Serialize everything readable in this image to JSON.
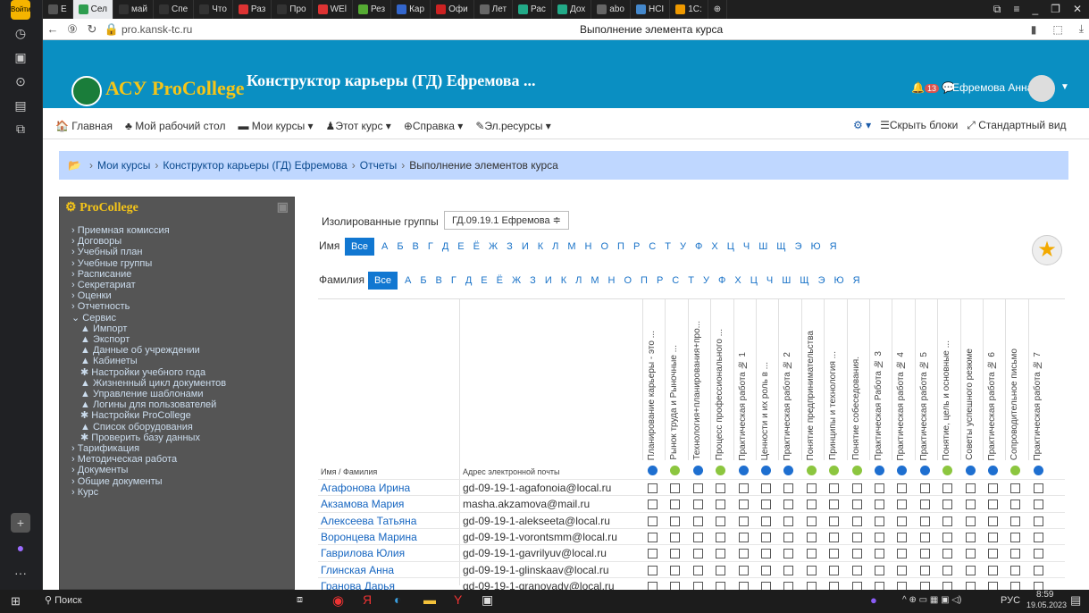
{
  "browser": {
    "tabs": [
      "Е",
      "Сел",
      "май",
      "Спе",
      "Что",
      "Раз",
      "Про",
      "WEl",
      "Рез",
      "Кар",
      "Офи",
      "Лет",
      "Рас",
      "Дох",
      "abo",
      "НСI",
      "1С:"
    ],
    "url": "pro.kansk-tc.ru",
    "page_title": "Выполнение элемента курса"
  },
  "header": {
    "logo": "АСУ ProCollege",
    "course_title": "Конструктор карьеры (ГД) Ефремова ...",
    "notif_count": "13",
    "user": "Ефремова Анна"
  },
  "nav": {
    "home": "Главная",
    "dashboard": "Мой рабочий стол",
    "my_courses": "Мои курсы",
    "this_course": "Этот курс",
    "help": "Справка",
    "resources": "Эл.ресурсы",
    "hide_blocks": "Скрыть блоки",
    "standard_view": "Стандартный вид"
  },
  "breadcrumbs": [
    "Мои курсы",
    "Конструктор карьеры (ГД) Ефремова",
    "Отчеты",
    "Выполнение элементов курса"
  ],
  "sidebar": {
    "title": "ProCollege",
    "items": [
      "Приемная комиссия",
      "Договоры",
      "Учебный план",
      "Учебные группы",
      "Расписание",
      "Секретариат",
      "Оценки",
      "Отчетность",
      "Сервис"
    ],
    "subitems": [
      "Импорт",
      "Экспорт",
      "Данные об учреждении",
      "Кабинеты",
      "Настройки учебного года",
      "Жизненный цикл документов",
      "Управление шаблонами",
      "Логины для пользователей",
      "Настройки ProCollege",
      "Список оборудования",
      "Проверить базу данных"
    ],
    "items_after": [
      "Тарификация",
      "Методическая работа",
      "Документы",
      "Общие документы",
      "Курс"
    ]
  },
  "filters": {
    "groups_label": "Изолированные группы",
    "group_value": "ГД.09.19.1 Ефремова ≑",
    "name_label": "Имя",
    "surname_label": "Фамилия",
    "all_label": "Все",
    "letters": [
      "А",
      "Б",
      "В",
      "Г",
      "Д",
      "Е",
      "Ё",
      "Ж",
      "З",
      "И",
      "К",
      "Л",
      "М",
      "Н",
      "О",
      "П",
      "Р",
      "С",
      "Т",
      "У",
      "Ф",
      "Х",
      "Ц",
      "Ч",
      "Ш",
      "Щ",
      "Э",
      "Ю",
      "Я"
    ]
  },
  "table": {
    "col_name_label": "Имя / Фамилия",
    "col_email_label": "Адрес электронной почты",
    "activities": [
      "Планирование карьеры - это ...",
      "Рынок труда и Рыночные ...",
      "Технология+планирования+про...",
      "Процесс профессионального ...",
      "Практическая работа № 1",
      "Ценности и их роль в ...",
      "Практическая работа № 2",
      "Понятие предпринимательства",
      "Принципы и технология ...",
      "Понятие собеседования.",
      "Практическая Работа № 3",
      "Практическая работа № 4",
      "Практическая работа № 5",
      "Понятие, цель и основные ...",
      "Советы успешного резюме",
      "Практическая работа № 6",
      "Сопроводительное письмо",
      "Практическая работа № 7"
    ],
    "activity_icon_colors": [
      "#1e6fd0",
      "#8cc63f",
      "#1e6fd0",
      "#8cc63f",
      "#1e6fd0",
      "#1e6fd0",
      "#1e6fd0",
      "#8cc63f",
      "#8cc63f",
      "#8cc63f",
      "#1e6fd0",
      "#1e6fd0",
      "#1e6fd0",
      "#8cc63f",
      "#1e6fd0",
      "#1e6fd0",
      "#8cc63f",
      "#1e6fd0"
    ],
    "rows": [
      {
        "name": "Агафонова Ирина",
        "email": "gd-09-19-1-agafonoia@local.ru"
      },
      {
        "name": "Акзамова Мария",
        "email": "masha.akzamova@mail.ru"
      },
      {
        "name": "Алексеева Татьяна",
        "email": "gd-09-19-1-alekseeta@local.ru"
      },
      {
        "name": "Воронцева Марина",
        "email": "gd-09-19-1-vorontsmm@local.ru"
      },
      {
        "name": "Гаврилова Юлия",
        "email": "gd-09-19-1-gavrilyuv@local.ru"
      },
      {
        "name": "Глинская Анна",
        "email": "gd-09-19-1-glinskaav@local.ru"
      },
      {
        "name": "Гранова Дарья",
        "email": "gd-09-19-1-granovadv@local.ru"
      }
    ]
  },
  "taskbar": {
    "search": "Поиск",
    "lang": "РУС",
    "time": "8:59",
    "date": "19.05.2023"
  }
}
